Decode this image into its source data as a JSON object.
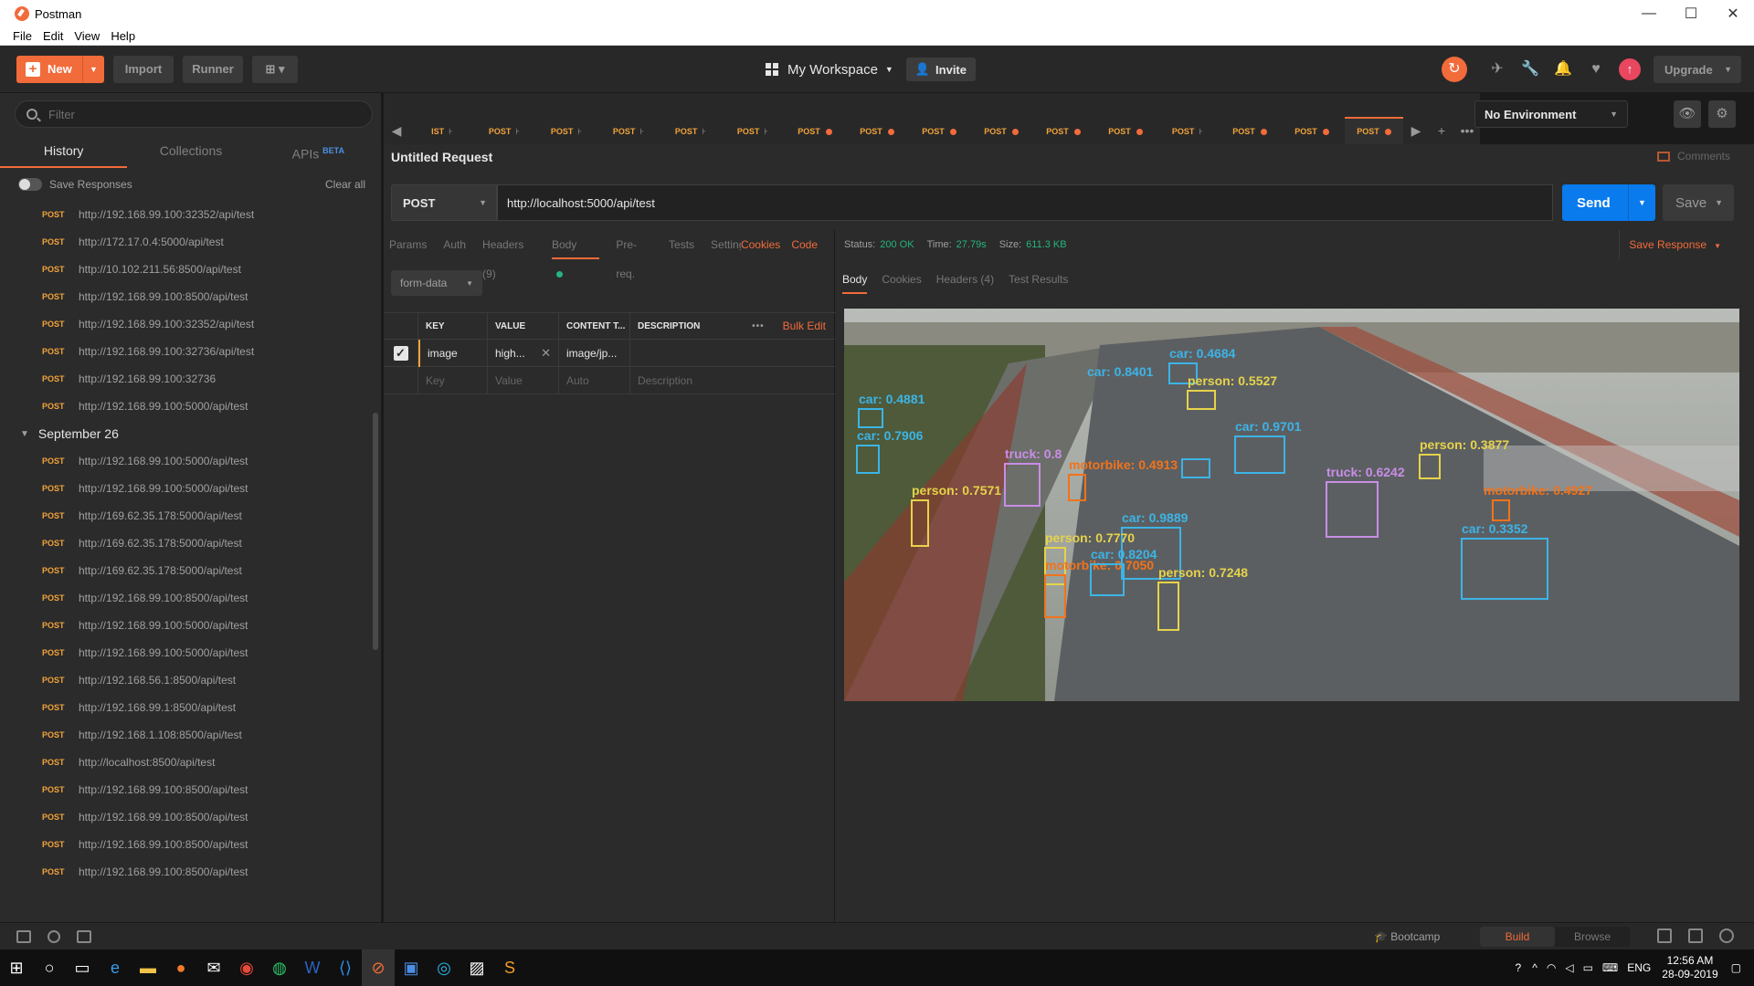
{
  "window": {
    "title": "Postman"
  },
  "menu": [
    "File",
    "Edit",
    "View",
    "Help"
  ],
  "header": {
    "new_label": "New",
    "import_label": "Import",
    "runner_label": "Runner",
    "workspace": "My Workspace",
    "invite": "Invite",
    "upgrade": "Upgrade"
  },
  "sidebar": {
    "filter_placeholder": "Filter",
    "tabs": {
      "history": "History",
      "collections": "Collections",
      "apis": "APIs",
      "apis_badge": "BETA"
    },
    "save_responses": "Save Responses",
    "clear_all": "Clear all",
    "top_items": [
      {
        "method": "POST",
        "url": "http://192.168.99.100:32352/api/test"
      },
      {
        "method": "POST",
        "url": "http://172.17.0.4:5000/api/test"
      },
      {
        "method": "POST",
        "url": "http://10.102.211.56:8500/api/test"
      },
      {
        "method": "POST",
        "url": "http://192.168.99.100:8500/api/test"
      },
      {
        "method": "POST",
        "url": "http://192.168.99.100:32352/api/test"
      },
      {
        "method": "POST",
        "url": "http://192.168.99.100:32736/api/test"
      },
      {
        "method": "POST",
        "url": "http://192.168.99.100:32736"
      },
      {
        "method": "POST",
        "url": "http://192.168.99.100:5000/api/test"
      }
    ],
    "group_label": "September 26",
    "group_items": [
      {
        "method": "POST",
        "url": "http://192.168.99.100:5000/api/test"
      },
      {
        "method": "POST",
        "url": "http://192.168.99.100:5000/api/test"
      },
      {
        "method": "POST",
        "url": "http://169.62.35.178:5000/api/test"
      },
      {
        "method": "POST",
        "url": "http://169.62.35.178:5000/api/test"
      },
      {
        "method": "POST",
        "url": "http://169.62.35.178:5000/api/test"
      },
      {
        "method": "POST",
        "url": "http://192.168.99.100:8500/api/test"
      },
      {
        "method": "POST",
        "url": "http://192.168.99.100:5000/api/test"
      },
      {
        "method": "POST",
        "url": "http://192.168.99.100:5000/api/test"
      },
      {
        "method": "POST",
        "url": "http://192.168.56.1:8500/api/test"
      },
      {
        "method": "POST",
        "url": "http://192.168.99.1:8500/api/test"
      },
      {
        "method": "POST",
        "url": "http://192.168.1.108:8500/api/test"
      },
      {
        "method": "POST",
        "url": "http://localhost:8500/api/test"
      },
      {
        "method": "POST",
        "url": "http://192.168.99.100:8500/api/test"
      },
      {
        "method": "POST",
        "url": "http://192.168.99.100:8500/api/test"
      },
      {
        "method": "POST",
        "url": "http://192.168.99.100:8500/api/test"
      },
      {
        "method": "POST",
        "url": "http://192.168.99.100:8500/api/test"
      }
    ]
  },
  "tabs": [
    {
      "label": "IST",
      "dirty": false
    },
    {
      "label": "POST",
      "dirty": false
    },
    {
      "label": "POST",
      "dirty": false
    },
    {
      "label": "POST",
      "dirty": false
    },
    {
      "label": "POST",
      "dirty": false
    },
    {
      "label": "POST",
      "dirty": false
    },
    {
      "label": "POST",
      "dirty": true
    },
    {
      "label": "POST",
      "dirty": true
    },
    {
      "label": "POST",
      "dirty": true
    },
    {
      "label": "POST",
      "dirty": true
    },
    {
      "label": "POST",
      "dirty": true
    },
    {
      "label": "POST",
      "dirty": true
    },
    {
      "label": "POST",
      "dirty": false
    },
    {
      "label": "POST",
      "dirty": true
    },
    {
      "label": "POST",
      "dirty": true
    },
    {
      "label": "POST",
      "dirty": true
    }
  ],
  "environment": "No Environment",
  "request": {
    "title": "Untitled Request",
    "comments": "Comments",
    "method": "POST",
    "url": "http://localhost:5000/api/test",
    "send": "Send",
    "save": "Save",
    "tabs": {
      "params": "Params",
      "auth": "Auth",
      "headers": "Headers (9)",
      "body": "Body",
      "prereq": "Pre-req.",
      "tests": "Tests",
      "settings": "Settings",
      "cookies": "Cookies",
      "code": "Code"
    },
    "body_mode": "form-data",
    "table": {
      "headers": [
        "KEY",
        "VALUE",
        "CONTENT T...",
        "DESCRIPTION"
      ],
      "bulk_edit": "Bulk Edit",
      "row": {
        "key": "image",
        "value": "high...",
        "content_type": "image/jp..."
      },
      "placeholders": {
        "key": "Key",
        "value": "Value",
        "content_type": "Auto",
        "description": "Description"
      }
    }
  },
  "response": {
    "status_label": "Status:",
    "status": "200 OK",
    "time_label": "Time:",
    "time": "27.79s",
    "size_label": "Size:",
    "size": "611.3 KB",
    "save_response": "Save Response",
    "tabs": {
      "body": "Body",
      "cookies": "Cookies",
      "headers": "Headers (4)",
      "tests": "Test Results"
    },
    "detections": [
      {
        "label": "car: 0.4881",
        "color": "#3cb4e6"
      },
      {
        "label": "car: 0.7906",
        "color": "#3cb4e6"
      },
      {
        "label": "person: 0.7571",
        "color": "#e6d34a"
      },
      {
        "label": "truck: 0.8",
        "color": "#c88ee6"
      },
      {
        "label": "motorbike: 0.4913",
        "color": "#f2731a"
      },
      {
        "label": "car: 0.4684",
        "color": "#3cb4e6"
      },
      {
        "label": "person: 0.5527",
        "color": "#e6d34a"
      },
      {
        "label": "car: 0.9701",
        "color": "#3cb4e6"
      },
      {
        "label": "truck: 0.6242",
        "color": "#c88ee6"
      },
      {
        "label": "person: 0.3877",
        "color": "#e6d34a"
      },
      {
        "label": "motorbike: 0.4927",
        "color": "#f2731a"
      },
      {
        "label": "car: 0.9889",
        "color": "#3cb4e6"
      },
      {
        "label": "person: 0.7770",
        "color": "#e6d34a"
      },
      {
        "label": "motorbike: 0.7050",
        "color": "#f2731a"
      },
      {
        "label": "person: 0.7248",
        "color": "#e6d34a"
      },
      {
        "label": "car: 0.3352",
        "color": "#3cb4e6"
      },
      {
        "label": "car: 0.8204",
        "color": "#3cb4e6"
      },
      {
        "label": "car: 0.8401",
        "color": "#3cb4e6"
      }
    ]
  },
  "footer": {
    "bootcamp": "Bootcamp",
    "build": "Build",
    "browse": "Browse"
  },
  "taskbar": {
    "lang": "ENG",
    "time": "12:56 AM",
    "date": "28-09-2019"
  },
  "colors": {
    "accent": "#f26b3a",
    "send": "#097bed",
    "method_post": "#f2a33a",
    "ok": "#26b47f"
  }
}
